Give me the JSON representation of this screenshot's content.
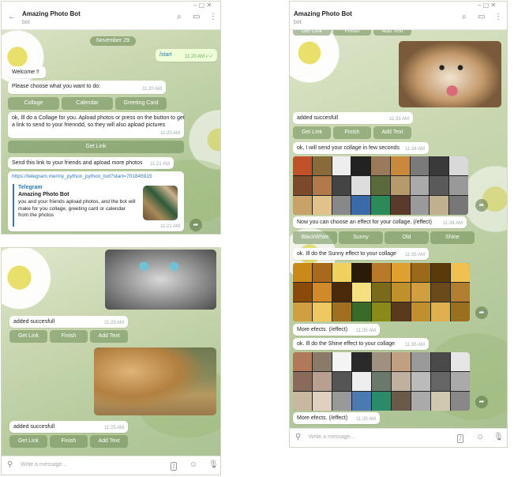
{
  "chat": {
    "title": "Amazing Photo Bot",
    "status": "bot",
    "date": "November 29",
    "input_placeholder": "Write a message..."
  },
  "panel1": {
    "start_text": "/start",
    "start_time": "11:20 AM",
    "welcome": "Welcome !!",
    "choose": "Please choose what you want to do:",
    "choose_time": "11:20 AM",
    "buttons": [
      "Collage",
      "Calendar",
      "Greeting Card"
    ],
    "collage_msg": "ok, Ill do a Collage for you. Apload photos or press on the button to get a link to send to your frienndd, so they will also apload pictures",
    "collage_time": "11:20 AM",
    "getlink_label": "Get Link",
    "send_msg": "Send this link to your friends and apload more photos",
    "send_time": "11:21 AM",
    "link_url": "https://telegram.me/my_python_python_bot?start=701845915",
    "preview_site": "Telegram",
    "preview_title": "Amazing Photo Bot",
    "preview_desc": "you and your friends apload photos,  and the bot will make for you collage, greeting card or calendar from the photos",
    "preview_time": "11:21 AM"
  },
  "panel2": {
    "added1": "added succesfull",
    "added1_time": "11:25 AM",
    "added2": "added succesfull",
    "added2_time": "11:25 AM",
    "buttons": [
      "Get Link",
      "Finish",
      "Add Text"
    ]
  },
  "panel3": {
    "top_buttons": [
      "Get Link",
      "Finish",
      "Add Text"
    ],
    "added": "added succesfull",
    "added_time": "11:33 AM",
    "buttons": [
      "Get Link",
      "Finish",
      "Add Text"
    ],
    "send_collage": "ok, I will send your collage in few seconds",
    "send_time": "11:34 AM",
    "effect_msg": "Now you can choose an effect for your collage. (/effect)",
    "effect_time": "11:34 AM",
    "effect_buttons": [
      "BlackWhite",
      "Sunny",
      "Old",
      "Shine"
    ],
    "sunny_msg": "ok. Ill do  the Sunny effect to your collage",
    "sunny_time": "11:35 AM",
    "more1": "More efects. (/effect)",
    "more1_time": "11:35 AM",
    "shine_msg": "ok. Ill do  the Shine effect to your collage",
    "shine_time": "11:35 AM",
    "more2": "More efects. (/effect)",
    "more2_time": "11:35 AM"
  },
  "icons": {
    "back": "back-arrow-icon",
    "search": "search-icon",
    "sidebar": "sidebar-toggle-icon",
    "more": "more-vertical-icon",
    "attach": "paperclip-icon",
    "command": "command-icon",
    "emoji": "emoji-icon",
    "mic": "microphone-icon",
    "share": "share-arrow-icon",
    "read": "double-check-icon"
  },
  "colors": {
    "outgoing_bubble": "#eefed9",
    "keyboard_button": "#6e8c55",
    "link": "#2a7ab8",
    "background": "#c9d7b0"
  }
}
